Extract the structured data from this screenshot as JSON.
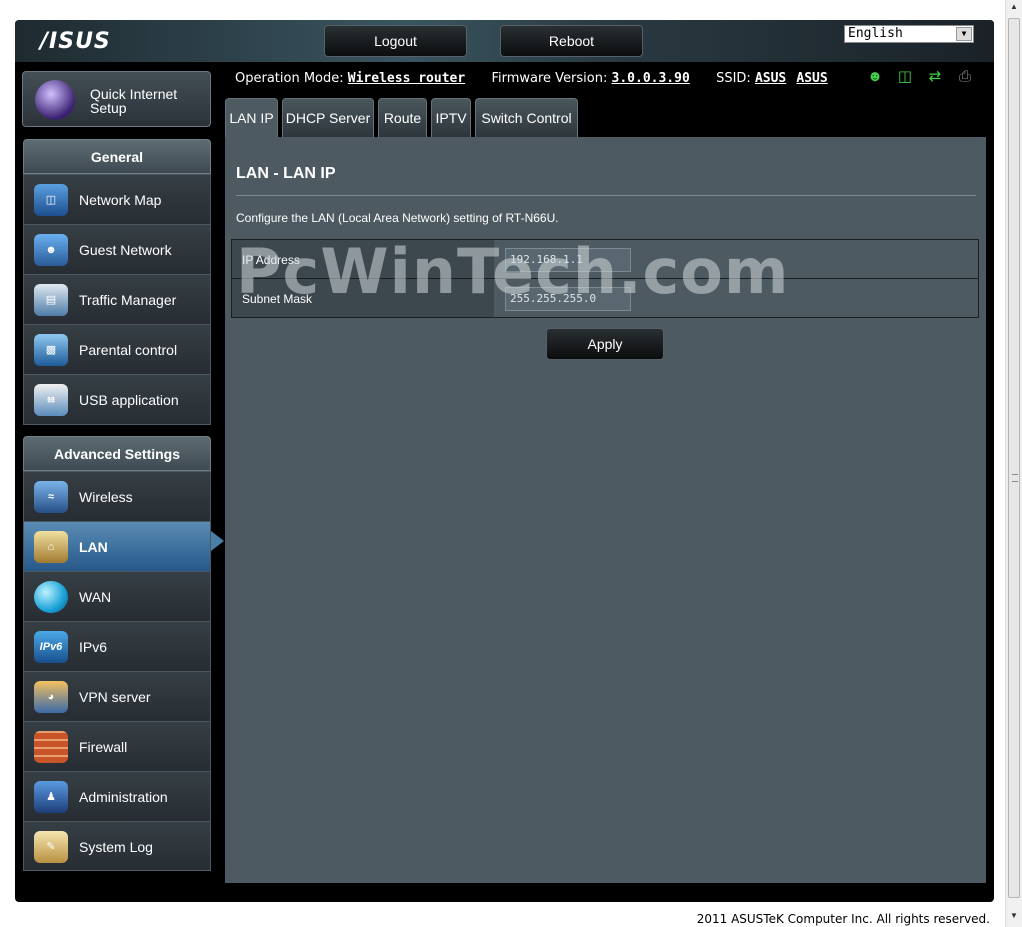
{
  "header": {
    "logo": "/ISUS",
    "logout_label": "Logout",
    "reboot_label": "Reboot",
    "language": "English"
  },
  "status": {
    "operation_mode_label": "Operation Mode:",
    "operation_mode_value": "Wireless router",
    "firmware_label": "Firmware Version:",
    "firmware_value": "3.0.0.3.90",
    "ssid_label": "SSID:",
    "ssid_values": [
      "ASUS",
      "ASUS"
    ]
  },
  "sidebar": {
    "quick_setup_label": "Quick Internet Setup",
    "general_heading": "General",
    "general_items": [
      {
        "label": "Network Map",
        "icon": "network-map-icon"
      },
      {
        "label": "Guest Network",
        "icon": "guest-network-icon"
      },
      {
        "label": "Traffic Manager",
        "icon": "traffic-manager-icon"
      },
      {
        "label": "Parental control",
        "icon": "parental-control-icon"
      },
      {
        "label": "USB application",
        "icon": "usb-application-icon"
      }
    ],
    "advanced_heading": "Advanced Settings",
    "advanced_items": [
      {
        "label": "Wireless",
        "icon": "wireless-icon"
      },
      {
        "label": "LAN",
        "icon": "lan-icon"
      },
      {
        "label": "WAN",
        "icon": "wan-globe-icon"
      },
      {
        "label": "IPv6",
        "icon": "ipv6-icon"
      },
      {
        "label": "VPN server",
        "icon": "vpn-server-icon"
      },
      {
        "label": "Firewall",
        "icon": "firewall-icon"
      },
      {
        "label": "Administration",
        "icon": "administration-icon"
      },
      {
        "label": "System Log",
        "icon": "system-log-icon"
      }
    ]
  },
  "tabs": [
    "LAN IP",
    "DHCP Server",
    "Route",
    "IPTV",
    "Switch Control"
  ],
  "main": {
    "title": "LAN - LAN IP",
    "description": "Configure the LAN (Local Area Network) setting of RT-N66U.",
    "fields": [
      {
        "label": "IP Address",
        "value": "192.168.1.1"
      },
      {
        "label": "Subnet Mask",
        "value": "255.255.255.0"
      }
    ],
    "apply_label": "Apply",
    "watermark": "PcWinTech.com"
  },
  "footer": "2011 ASUSTeK Computer Inc. All rights reserved.",
  "colors": {
    "accent_active": "#3b6e9c",
    "panel": "#4d5a61",
    "status_icon_green": "#44d04a"
  }
}
